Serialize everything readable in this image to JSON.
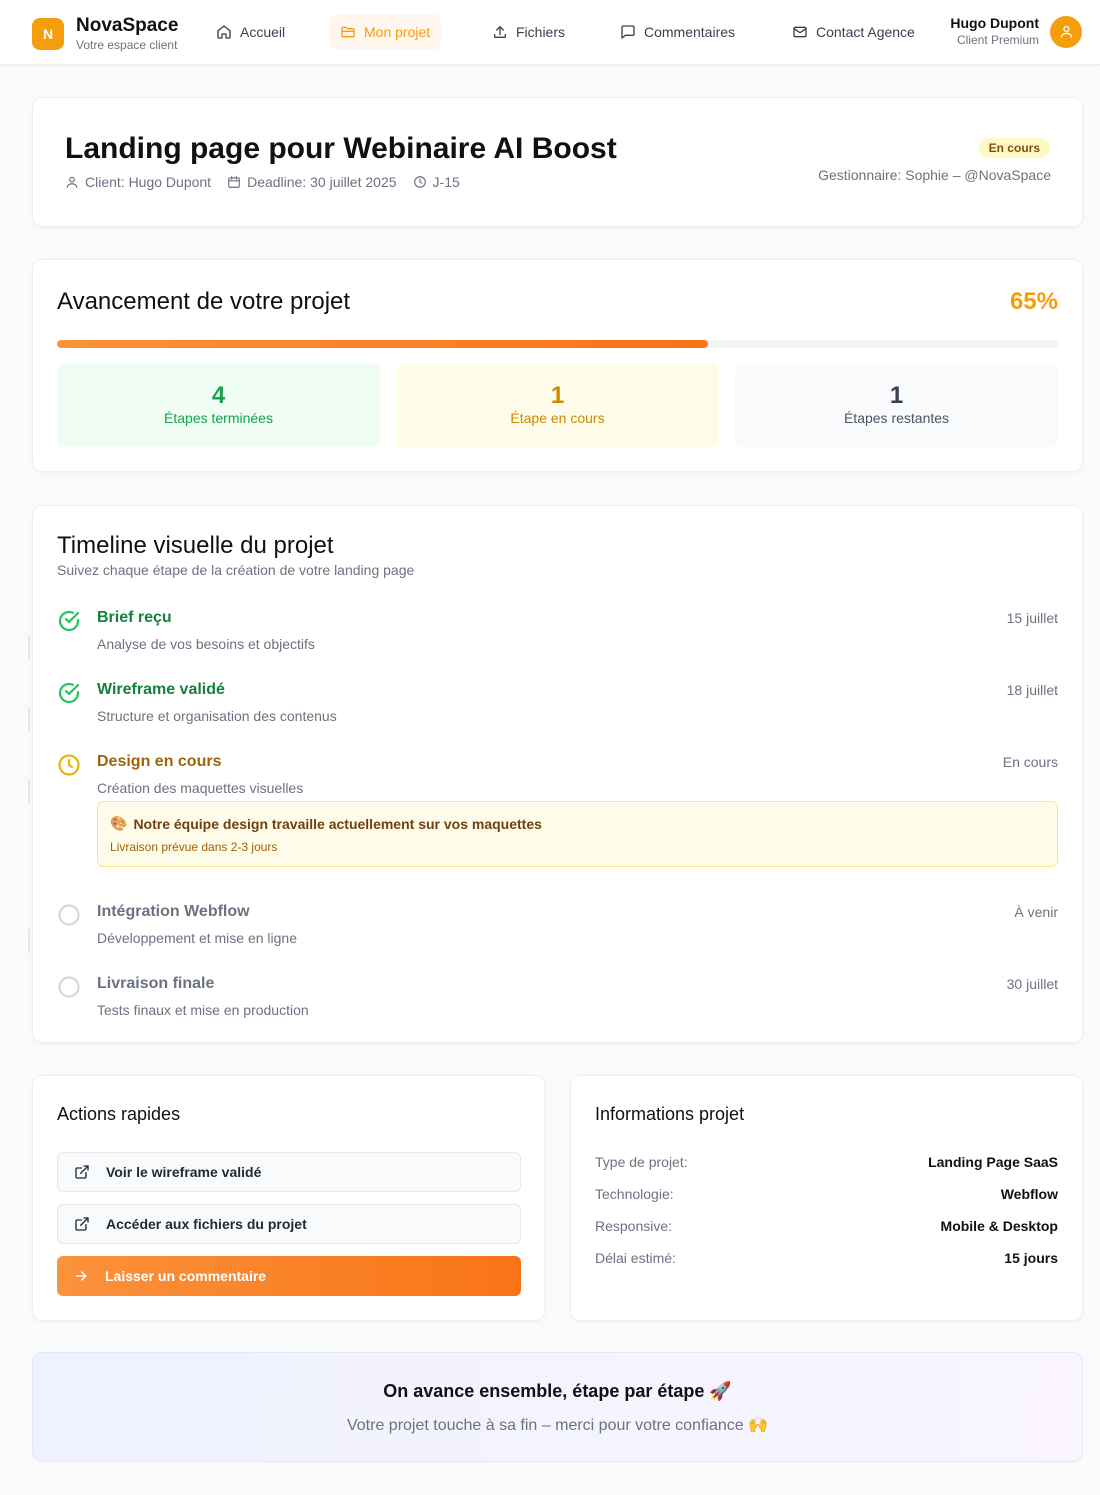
{
  "header": {
    "brand_initial": "N",
    "brand_name": "NovaSpace",
    "brand_sub": "Votre espace client",
    "nav": [
      {
        "label": "Accueil",
        "icon": "home-icon"
      },
      {
        "label": "Mon projet",
        "icon": "folder-icon",
        "active": true
      },
      {
        "label": "Fichiers",
        "icon": "upload-icon"
      },
      {
        "label": "Commentaires",
        "icon": "comment-icon"
      },
      {
        "label": "Contact Agence",
        "icon": "mail-icon"
      }
    ],
    "user_name": "Hugo Dupont",
    "user_role": "Client Premium"
  },
  "project": {
    "title": "Landing page pour Webinaire AI Boost",
    "client": "Client: Hugo Dupont",
    "deadline": "Deadline: 30 juillet 2025",
    "countdown": "J-15",
    "status": "En cours",
    "manager": "Gestionnaire: Sophie – @NovaSpace"
  },
  "progress": {
    "title": "Avancement de votre projet",
    "percent_label": "65%",
    "percent": 65,
    "stats": [
      {
        "value": "4",
        "label": "Étapes terminées"
      },
      {
        "value": "1",
        "label": "Étape en cours"
      },
      {
        "value": "1",
        "label": "Étapes restantes"
      }
    ]
  },
  "timeline": {
    "title": "Timeline visuelle du projet",
    "subtitle": "Suivez chaque étape de la création de votre landing page",
    "steps": [
      {
        "title": "Brief reçu",
        "desc": "Analyse de vos besoins et objectifs",
        "date": "15 juillet",
        "status": "done"
      },
      {
        "title": "Wireframe validé",
        "desc": "Structure et organisation des contenus",
        "date": "18 juillet",
        "status": "done"
      },
      {
        "title": "Design en cours",
        "desc": "Création des maquettes visuelles",
        "date": "En cours",
        "status": "current"
      },
      {
        "title": "Intégration Webflow",
        "desc": "Développement et mise en ligne",
        "date": "À venir",
        "status": "pending"
      },
      {
        "title": "Livraison finale",
        "desc": "Tests finaux et mise en production",
        "date": "30 juillet",
        "status": "pending"
      }
    ],
    "notice": {
      "emoji": "🎨",
      "title": "Notre équipe design travaille actuellement sur vos maquettes",
      "sub": "Livraison prévue dans 2-3 jours"
    }
  },
  "actions": {
    "title": "Actions rapides",
    "buttons": [
      {
        "label": "Voir le wireframe validé",
        "icon": "external-link-icon"
      },
      {
        "label": "Accéder aux fichiers du projet",
        "icon": "external-link-icon"
      },
      {
        "label": "Laisser un commentaire",
        "icon": "arrow-right-icon"
      }
    ]
  },
  "info": {
    "title": "Informations projet",
    "rows": [
      {
        "key": "Type de projet:",
        "value": "Landing Page SaaS"
      },
      {
        "key": "Technologie:",
        "value": "Webflow"
      },
      {
        "key": "Responsive:",
        "value": "Mobile & Desktop"
      },
      {
        "key": "Délai estimé:",
        "value": "15 jours"
      }
    ]
  },
  "banner": {
    "title": "On avance ensemble, étape par étape 🚀",
    "sub": "Votre projet touche à sa fin – merci pour votre confiance 🙌"
  },
  "colors": {
    "accent": "#f59e0b",
    "success": "#16a34a",
    "warning": "#ca8a04",
    "muted": "#6b7280"
  }
}
